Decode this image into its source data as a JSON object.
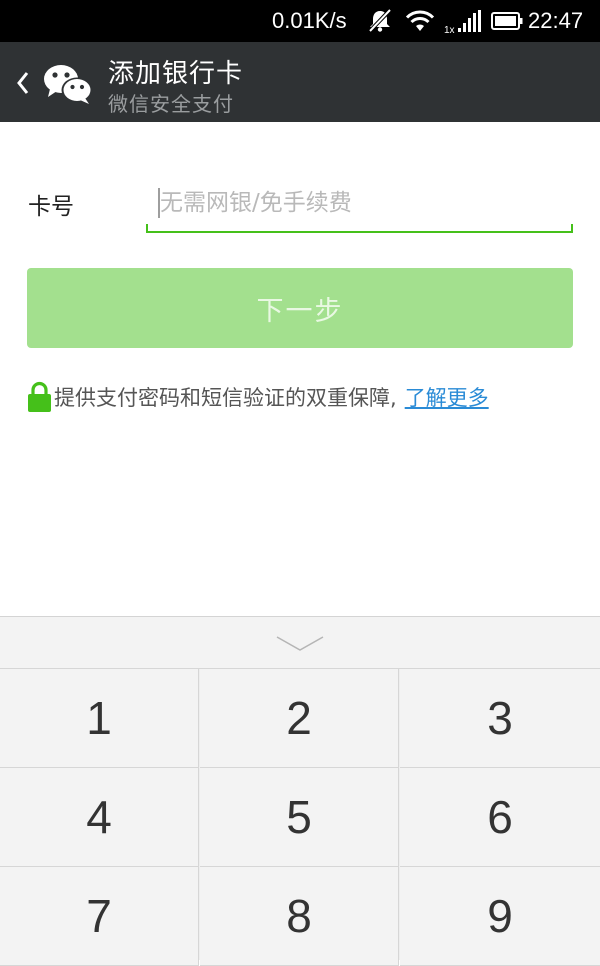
{
  "status_bar": {
    "net_speed": "0.01K/s",
    "signal_label": "1x",
    "time": "22:47",
    "icons": [
      "mute-icon",
      "wifi-icon",
      "signal-icon",
      "battery-icon"
    ]
  },
  "header": {
    "title": "添加银行卡",
    "subtitle": "微信安全支付",
    "back_icon": "back-arrow-icon",
    "logo_icon": "wechat-icon",
    "background": "#2f3234"
  },
  "form": {
    "card_label": "卡号",
    "card_placeholder": "无需网银/免手续费",
    "card_value": "",
    "accent": "#45c01a"
  },
  "next_button": {
    "label": "下一步",
    "enabled": false,
    "color": "#a3e08e"
  },
  "security_note": {
    "icon": "lock-icon",
    "text": "提供支付密码和短信验证的双重保障,",
    "link": "了解更多",
    "link_color": "#2a8bd6"
  },
  "keypad": {
    "collapse_icon": "chevron-down-icon",
    "keys": [
      "1",
      "2",
      "3",
      "4",
      "5",
      "6",
      "7",
      "8",
      "9"
    ]
  }
}
